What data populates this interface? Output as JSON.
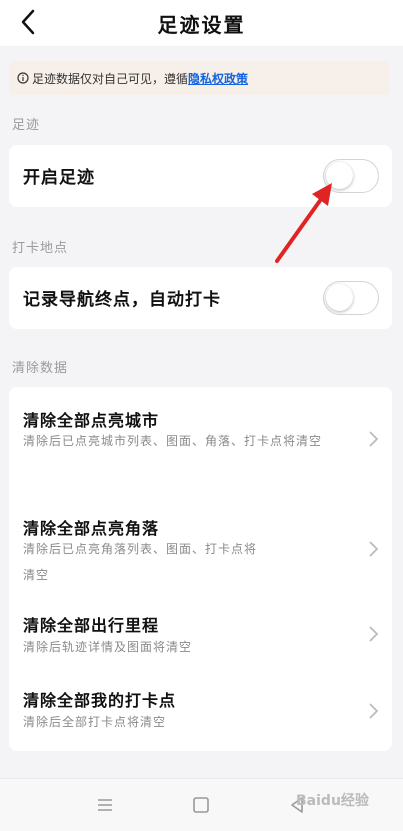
{
  "header": {
    "title": "足迹设置",
    "back_icon": "chevron-left-icon"
  },
  "notice": {
    "icon": "info-icon",
    "text": "足迹数据仅对自己可见，遵循",
    "link": "隐私权政策"
  },
  "sections": {
    "footprint": {
      "label": "足迹",
      "row": {
        "title": "开启足迹",
        "toggle": "off"
      }
    },
    "checkin": {
      "label": "打卡地点",
      "row": {
        "title": "记录导航终点，自动打卡",
        "toggle": "off"
      }
    },
    "clear": {
      "label": "清除数据",
      "items": [
        {
          "title": "清除全部点亮城市",
          "desc": "清除后已点亮城市列表、图面、角落、打卡点将清空"
        },
        {
          "title": "清除全部点亮角落",
          "desc": "清除后已点亮角落列表、图面、打卡点将清空"
        },
        {
          "title": "清除全部出行里程",
          "desc": "清除后轨迹详情及图面将清空"
        },
        {
          "title": "清除全部我的打卡点",
          "desc": "清除后全部打卡点将清空"
        }
      ]
    }
  },
  "bottom_nav": {
    "icons": [
      "menu-icon",
      "home-square-icon",
      "back-triangle-icon"
    ]
  },
  "watermark": "Baidu经验",
  "colors": {
    "accent_link": "#1565e0",
    "annotation_arrow": "#e02424"
  }
}
